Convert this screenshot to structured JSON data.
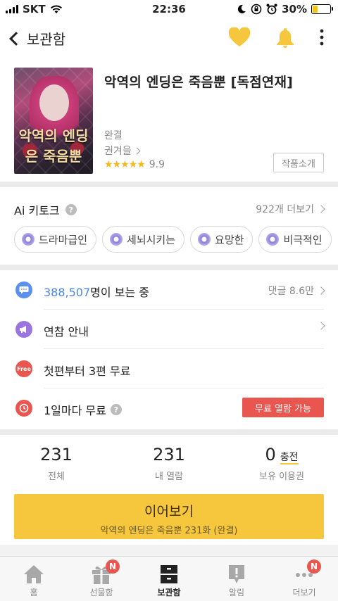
{
  "status_bar": {
    "carrier": "SKT",
    "time": "22:36",
    "battery": "30%",
    "battery_level": 0.3
  },
  "nav": {
    "back_label": "보관함",
    "icons": [
      "heart-icon",
      "bell-icon",
      "more-vertical-icon"
    ],
    "accent": "#f6c73c"
  },
  "book": {
    "title": "악역의 엔딩은 죽음뿐 [독점연재]",
    "cover_text": "악역의 엔딩은 죽음뿐",
    "status": "완결",
    "author": "권겨을",
    "rating": "9.9",
    "stars": "★★★★★",
    "intro_button": "작품소개"
  },
  "keywords": {
    "label": "Ai 키토크",
    "more": "922개 더보기",
    "chips": [
      "드라마급인",
      "세뇌시키는",
      "요망한",
      "비극적인"
    ]
  },
  "info": {
    "readers_count": "388,507",
    "readers_suffix": "명이 보는 중",
    "comments": "댓글 8.6만",
    "notice": "연참 안내",
    "free_first": "첫편부터 3편 무료",
    "free_badge": "Free",
    "daily_free": "1일마다 무료",
    "free_unlock_button": "무료 열람 가능"
  },
  "stats": {
    "total": "231",
    "total_label": "전체",
    "opened": "231",
    "opened_label": "내 열람",
    "tickets": "0",
    "charge": "충전",
    "tickets_label": "보유 이용권"
  },
  "continue": {
    "label": "이어보기",
    "sub": "악역의 엔딩은 죽음뿐 231화 (완결)"
  },
  "tabbar": {
    "tabs": [
      {
        "label": "홈",
        "icon": "home-icon"
      },
      {
        "label": "선물함",
        "icon": "gift-icon",
        "badge": "N"
      },
      {
        "label": "보관함",
        "icon": "storage-icon",
        "active": true
      },
      {
        "label": "알림",
        "icon": "notification-icon"
      },
      {
        "label": "더보기",
        "icon": "more-horizontal-icon",
        "badge": "N"
      }
    ]
  }
}
